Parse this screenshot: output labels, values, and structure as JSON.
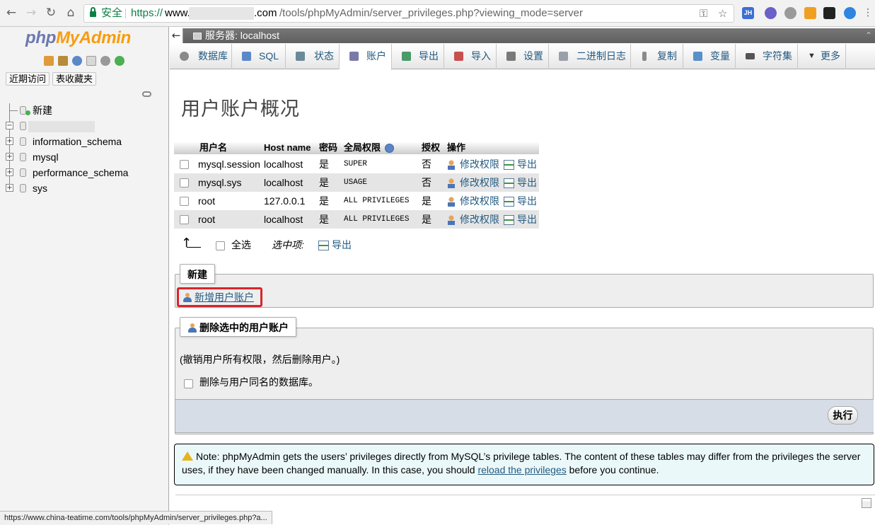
{
  "browser": {
    "secure_label": "安全",
    "url_scheme": "https://",
    "url_host_a": "www.",
    "url_host_b": ".com",
    "url_rest": "/tools/phpMyAdmin/server_privileges.php?viewing_mode=server",
    "extensions": [
      "JH"
    ],
    "status_url": "https://www.china-teatime.com/tools/phpMyAdmin/server_privileges.php?a..."
  },
  "sidebar": {
    "logo_php": "php",
    "logo_myadmin": "MyAdmin",
    "recent_label": "近期访问",
    "favorites_label": "表收藏夹",
    "tree": [
      {
        "label": "新建"
      },
      {
        "label": ""
      },
      {
        "label": "information_schema"
      },
      {
        "label": "mysql"
      },
      {
        "label": "performance_schema"
      },
      {
        "label": "sys"
      }
    ]
  },
  "server_bar": {
    "label": "服务器: localhost"
  },
  "tabs": [
    {
      "label": "数据库",
      "color": "#8a8a8a"
    },
    {
      "label": "SQL",
      "color": "#5a88c8"
    },
    {
      "label": "状态",
      "color": "#6a8a9a"
    },
    {
      "label": "账户",
      "color": "#7a7aaa"
    },
    {
      "label": "导出",
      "color": "#4a9a6a"
    },
    {
      "label": "导入",
      "color": "#c85050"
    },
    {
      "label": "设置",
      "color": "#7a7a7a"
    },
    {
      "label": "二进制日志",
      "color": "#9aa0aa"
    },
    {
      "label": "复制",
      "color": "#8a8a8a"
    },
    {
      "label": "变量",
      "color": "#5a90c8"
    },
    {
      "label": "字符集",
      "color": "#555555"
    },
    {
      "label": "更多",
      "color": "#333333"
    }
  ],
  "page_title": "用户账户概况",
  "user_table": {
    "headers": [
      "用户名",
      "Host name",
      "密码",
      "全局权限",
      "授权",
      "操作"
    ],
    "rows": [
      {
        "user": "mysql.session",
        "host": "localhost",
        "password": "是",
        "privs": "SUPER",
        "grant": "否",
        "edit": "修改权限",
        "export": "导出"
      },
      {
        "user": "mysql.sys",
        "host": "localhost",
        "password": "是",
        "privs": "USAGE",
        "grant": "否",
        "edit": "修改权限",
        "export": "导出"
      },
      {
        "user": "root",
        "host": "127.0.0.1",
        "password": "是",
        "privs": "ALL PRIVILEGES",
        "grant": "是",
        "edit": "修改权限",
        "export": "导出"
      },
      {
        "user": "root",
        "host": "localhost",
        "password": "是",
        "privs": "ALL PRIVILEGES",
        "grant": "是",
        "edit": "修改权限",
        "export": "导出"
      }
    ]
  },
  "bulk": {
    "select_all": "全选",
    "with_selected": "选中项:",
    "export": "导出"
  },
  "new_section": {
    "legend": "新建",
    "add_user": "新增用户账户"
  },
  "delete_section": {
    "legend": "删除选中的用户账户",
    "description": "(撤销用户所有权限，然后删除用户。)",
    "drop_db_label": "删除与用户同名的数据库。",
    "go": "执行"
  },
  "note": {
    "text_before": "Note: phpMyAdmin gets the users’ privileges directly from MySQL’s privilege tables. The content of these tables may differ from the privileges the server uses, if they have been changed manually. In this case, you should ",
    "link": "reload the privileges",
    "text_after": " before you continue."
  }
}
